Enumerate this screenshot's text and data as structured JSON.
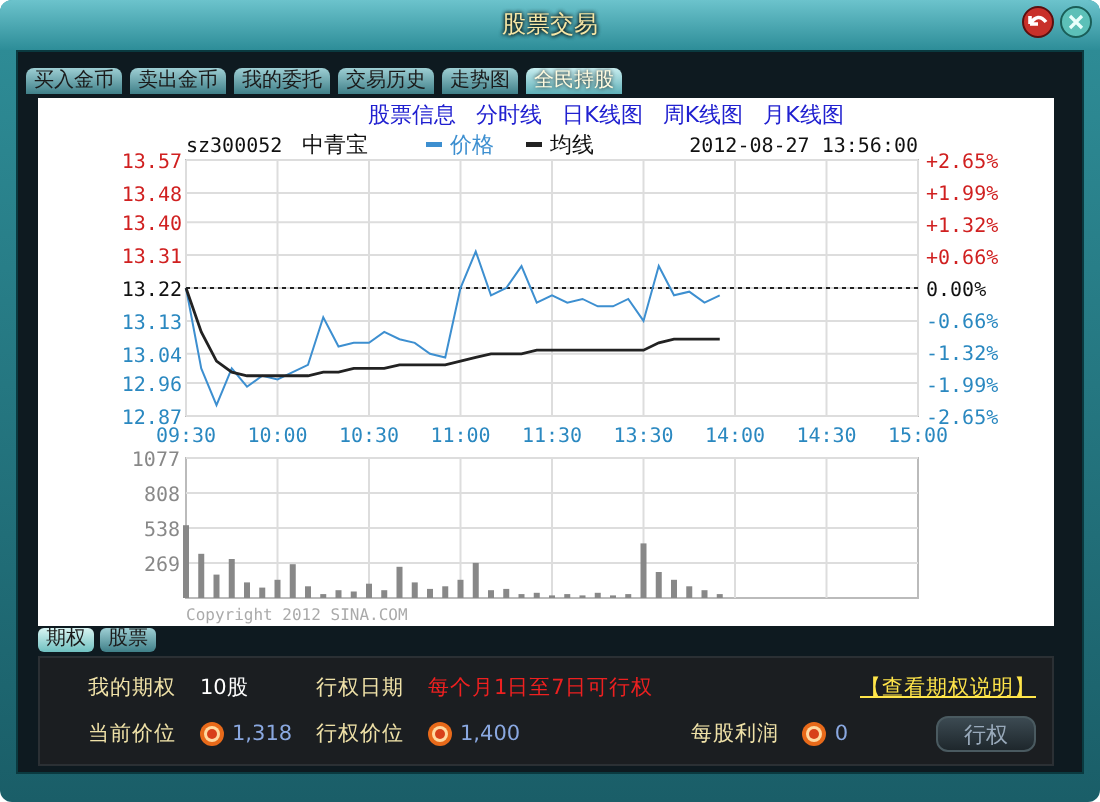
{
  "window": {
    "title": "股票交易"
  },
  "tabs": [
    {
      "label": "买入金币",
      "selected": false
    },
    {
      "label": "卖出金币",
      "selected": false
    },
    {
      "label": "我的委托",
      "selected": false
    },
    {
      "label": "交易历史",
      "selected": false
    },
    {
      "label": "走势图",
      "selected": false
    },
    {
      "label": "全民持股",
      "selected": true
    }
  ],
  "chart_links": [
    "股票信息",
    "分时线",
    "日K线图",
    "周K线图",
    "月K线图"
  ],
  "price_chart": {
    "code": "sz300052",
    "name": "中青宝",
    "datetime": "2012-08-27 13:56:00",
    "right_axis_labels": [
      "+2.65%",
      "+1.99%",
      "+1.32%",
      "+0.66%",
      "0.00%",
      "-0.66%",
      "-1.32%",
      "-1.99%",
      "-2.65%"
    ],
    "chart_data": {
      "type": "line",
      "grid": true,
      "legend": "top",
      "categories": [
        "09:30",
        null,
        null,
        null,
        null,
        null,
        "10:00",
        null,
        null,
        null,
        null,
        null,
        "10:30",
        null,
        null,
        null,
        null,
        null,
        "11:00",
        null,
        null,
        null,
        null,
        null,
        "11:30",
        null,
        null,
        null,
        null,
        null,
        "13:30",
        null,
        null,
        null,
        null,
        null,
        "14:00",
        null,
        null,
        null,
        null,
        null,
        "14:30",
        null,
        null,
        null,
        null,
        null,
        "15:00"
      ],
      "series": [
        {
          "name": "价格",
          "color": "#3d8fd0",
          "values": [
            13.22,
            13.0,
            12.9,
            13.0,
            12.95,
            12.98,
            12.97,
            12.99,
            13.01,
            13.14,
            13.06,
            13.07,
            13.07,
            13.1,
            13.08,
            13.07,
            13.04,
            13.03,
            13.22,
            13.32,
            13.2,
            13.22,
            13.28,
            13.18,
            13.2,
            13.18,
            13.19,
            13.17,
            13.17,
            13.19,
            13.13,
            13.28,
            13.2,
            13.21,
            13.18,
            13.2,
            null,
            null,
            null,
            null,
            null,
            null,
            null,
            null,
            null,
            null,
            null,
            null,
            null
          ]
        },
        {
          "name": "均线",
          "color": "#222222",
          "values": [
            13.22,
            13.1,
            13.02,
            12.99,
            12.98,
            12.98,
            12.98,
            12.98,
            12.98,
            12.99,
            12.99,
            13.0,
            13.0,
            13.0,
            13.01,
            13.01,
            13.01,
            13.01,
            13.02,
            13.03,
            13.04,
            13.04,
            13.04,
            13.05,
            13.05,
            13.05,
            13.05,
            13.05,
            13.05,
            13.05,
            13.05,
            13.07,
            13.08,
            13.08,
            13.08,
            13.08,
            null,
            null,
            null,
            null,
            null,
            null,
            null,
            null,
            null,
            null,
            null,
            null,
            null
          ]
        }
      ],
      "ylim": [
        12.87,
        13.57
      ],
      "yticks": [
        13.57,
        13.48,
        {
          "value": 13.4,
          "label": "13.40"
        },
        13.31,
        13.22,
        13.13,
        13.04,
        12.96,
        12.87
      ],
      "ref_lines": [
        {
          "axis": "y",
          "value": 13.22
        }
      ]
    }
  },
  "volume_chart": {
    "copyright": "Copyright 2012 SINA.COM",
    "chart_data": {
      "type": "bar",
      "grid": true,
      "categories": [
        null,
        null,
        null,
        null,
        null,
        null,
        null,
        null,
        null,
        null,
        null,
        null,
        null,
        null,
        null,
        null,
        null,
        null,
        null,
        null,
        null,
        null,
        null,
        null,
        null,
        null,
        null,
        null,
        null,
        null,
        null,
        null,
        null,
        null,
        null,
        null,
        null,
        null,
        null,
        null,
        null,
        null,
        null,
        null,
        null,
        null,
        null,
        null,
        null
      ],
      "values": [
        560,
        340,
        180,
        300,
        120,
        80,
        140,
        260,
        90,
        30,
        60,
        50,
        110,
        60,
        240,
        120,
        70,
        90,
        140,
        270,
        60,
        70,
        30,
        40,
        20,
        30,
        20,
        40,
        20,
        30,
        420,
        200,
        140,
        90,
        60,
        30,
        null,
        null,
        null,
        null,
        null,
        null,
        null,
        null,
        null,
        null,
        null,
        null,
        null
      ],
      "ylim": [
        0,
        1077
      ],
      "yticks": [
        1077,
        808,
        538,
        269
      ]
    }
  },
  "bottom_tabs": [
    {
      "label": "期权",
      "selected": true
    },
    {
      "label": "股票",
      "selected": false
    }
  ],
  "option_info": {
    "my_option_label": "我的期权",
    "my_option_value": "10股",
    "exercise_date_label": "行权日期",
    "exercise_date_value": "每个月1日至7日可行权",
    "help_link": "【查看期权说明】",
    "current_price_label": "当前价位",
    "current_price": "1,318",
    "exercise_price_label": "行权价位",
    "exercise_price": "1,400",
    "profit_label": "每股利润",
    "profit": "0",
    "exercise_button": "行权"
  }
}
